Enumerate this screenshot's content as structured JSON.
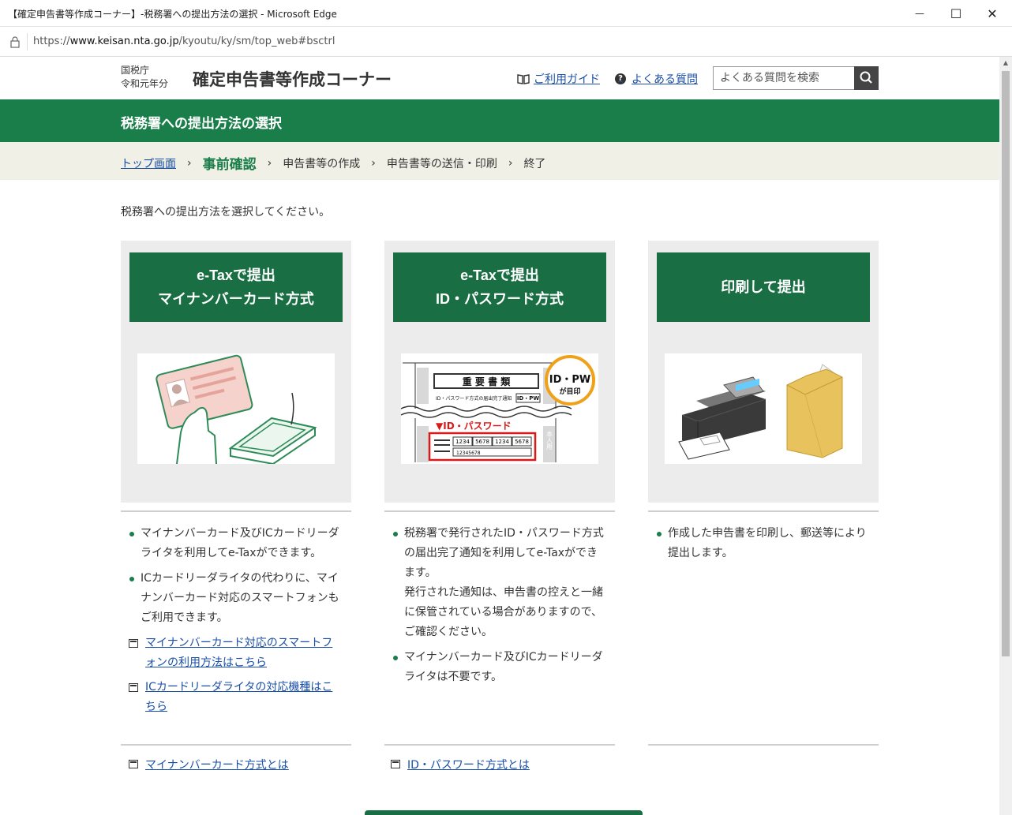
{
  "browser": {
    "window_title": "【確定申告書等作成コーナー】-税務署への提出方法の選択 - Microsoft Edge",
    "url_prefix": "https://",
    "url_host": "www.keisan.nta.go.jp",
    "url_path": "/kyoutu/ky/sm/top_web#bsctrl",
    "minimize": "—",
    "maximize": "☐",
    "close": "✕"
  },
  "header": {
    "agency_line1": "国税庁",
    "agency_line2": "令和元年分",
    "site_title": "確定申告書等作成コーナー",
    "guide_link": "ご利用ガイド",
    "faq_link": "よくある質問",
    "search_placeholder": "よくある質問を検索"
  },
  "page_heading": "税務署への提出方法の選択",
  "breadcrumb": {
    "top": "トップ画面",
    "step1": "事前確認",
    "step2": "申告書等の作成",
    "step3": "申告書等の送信・印刷",
    "step4": "終了",
    "sep": "›"
  },
  "instruction": "税務署への提出方法を選択してください。",
  "options": [
    {
      "line1": "e-Taxで提出",
      "line2": "マイナンバーカード方式",
      "bullets": [
        [
          "マイナンバーカード及びICカードリーダ",
          "ライタを利用してe-Taxができます。"
        ],
        [
          "ICカードリーダライタの代わりに、マイ",
          "ナンバーカード対応のスマートフォンも",
          "ご利用できます。"
        ]
      ],
      "links": [
        [
          "マイナンバーカード対応のスマートフ",
          "ォンの利用方法はこちら"
        ],
        [
          "ICカードリーダライタの対応機種はこ",
          "ちら"
        ]
      ],
      "bottom_link": "マイナンバーカード方式とは"
    },
    {
      "line1": "e-Taxで提出",
      "line2": "ID・パスワード方式",
      "bullets": [
        [
          "税務署で発行されたID・パスワード方式",
          "の届出完了通知を利用してe-Taxができ",
          "ます。",
          "発行された通知は、申告書の控えと一緒",
          "に保管されている場合がありますので、",
          "ご確認ください。"
        ],
        [
          "マイナンバーカード及びICカードリーダ",
          "ライタは不要です。"
        ]
      ],
      "bottom_link": "ID・パスワード方式とは"
    },
    {
      "line1": "印刷して提出",
      "bullets": [
        [
          "作成した申告書を印刷し、郵送等により",
          "提出します。"
        ]
      ]
    }
  ],
  "illustration_text": {
    "doc_title": "重 要 書 類",
    "doc_sub": "ID・パスワード方式の届出完了通知",
    "id_pw_badge": "ID・PW",
    "badge_sub": "が目印",
    "id_pw_label": "▼ID・パスワード",
    "copy_side": "本人用",
    "code1": "1234",
    "code2": "5678",
    "code3": "1234",
    "code4": "5678",
    "code5": "12345678"
  },
  "colors": {
    "brand_green": "#1a7e4a",
    "button_green": "#1a6e44",
    "link_blue": "#1a4fa8",
    "breadcrumb_bg": "#f1f0e6"
  }
}
